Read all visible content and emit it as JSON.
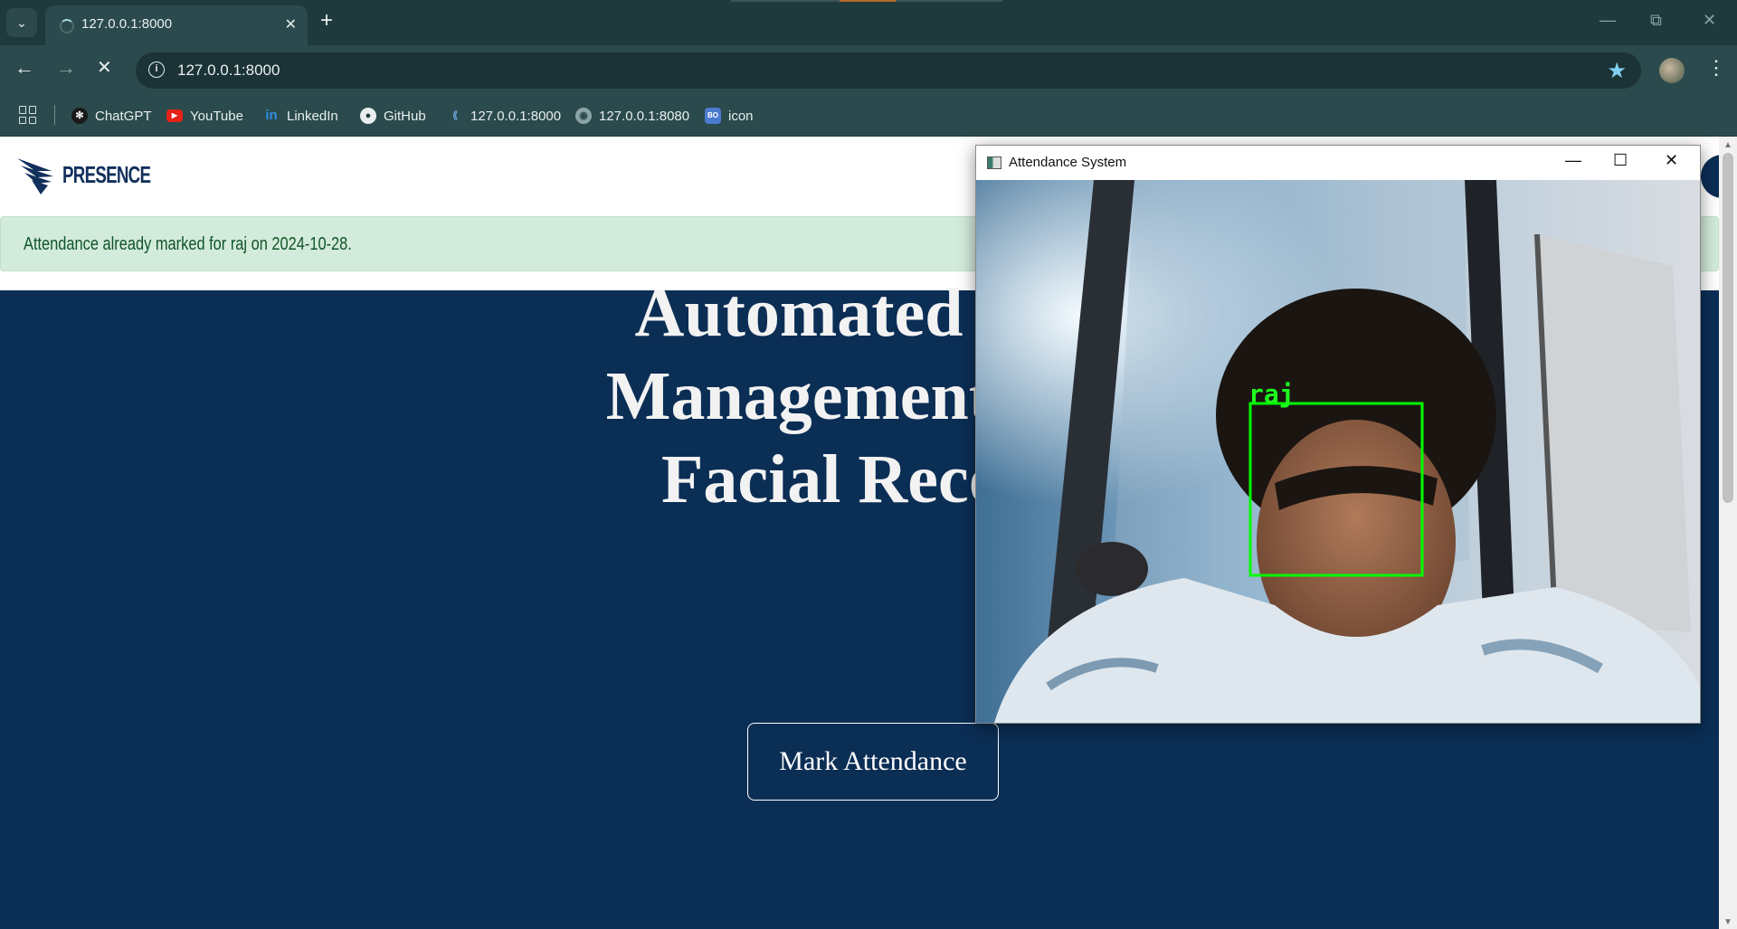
{
  "browser": {
    "tab_title": "127.0.0.1:8000",
    "url": "127.0.0.1:8000",
    "bookmarks": [
      {
        "label": "ChatGPT",
        "icon": "chatgpt-icon"
      },
      {
        "label": "YouTube",
        "icon": "youtube-icon"
      },
      {
        "label": "LinkedIn",
        "icon": "linkedin-icon"
      },
      {
        "label": "GitHub",
        "icon": "github-icon"
      },
      {
        "label": "127.0.0.1:8000",
        "icon": "site-icon"
      },
      {
        "label": "127.0.0.1:8080",
        "icon": "globe-icon"
      },
      {
        "label": "icon",
        "icon": "bo-icon"
      }
    ]
  },
  "site": {
    "brand": "PRESENCE",
    "alert": "Attendance already marked for raj on 2024-10-28.",
    "hero_lines": [
      "Automated Atte",
      "Management Syst",
      "Facial Recogn"
    ],
    "cta_label": "Mark Attendance",
    "colors": {
      "hero_bg": "#0b2e55",
      "alert_bg": "#d3ebdb",
      "alert_text": "#0f5428"
    }
  },
  "camera_window": {
    "title": "Attendance System",
    "detected_name": "raj",
    "box_color": "#00ff00"
  }
}
